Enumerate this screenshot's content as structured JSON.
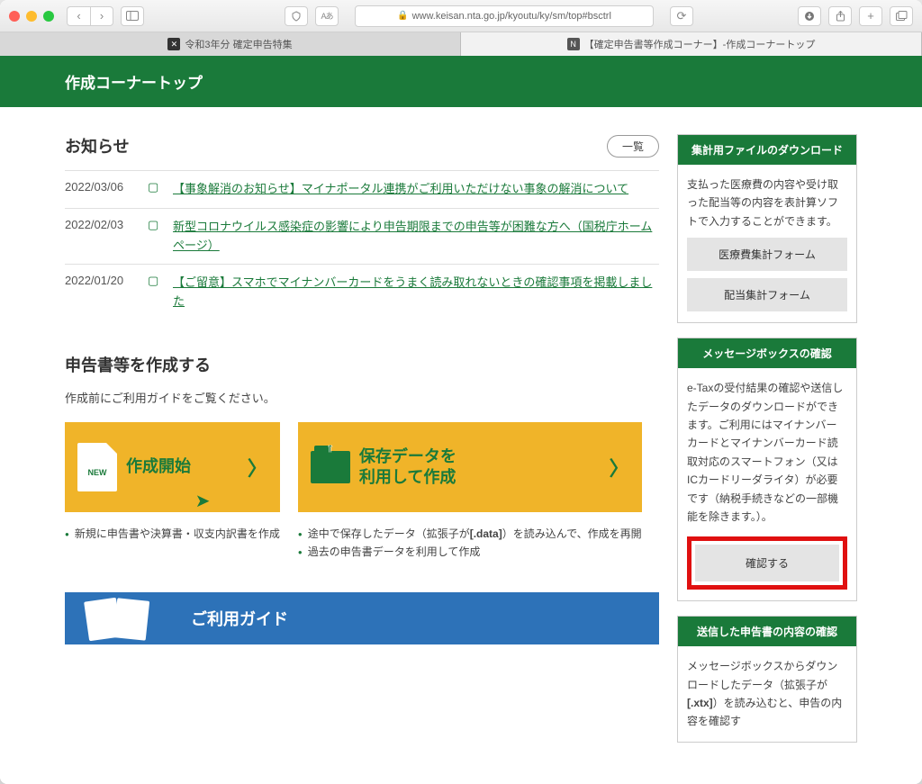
{
  "browser": {
    "url": "www.keisan.nta.go.jp/kyoutu/ky/sm/top#bsctrl",
    "tabs": [
      {
        "label": "令和3年分 確定申告特集"
      },
      {
        "label": "【確定申告書等作成コーナー】-作成コーナートップ"
      }
    ]
  },
  "header": {
    "title": "作成コーナートップ"
  },
  "news": {
    "title": "お知らせ",
    "more": "一覧",
    "items": [
      {
        "date": "2022/03/06",
        "link": "【事象解消のお知らせ】マイナポータル連携がご利用いただけない事象の解消について"
      },
      {
        "date": "2022/02/03",
        "link": "新型コロナウイルス感染症の影響により申告期限までの申告等が困難な方へ（国税庁ホームページ）"
      },
      {
        "date": "2022/01/20",
        "link": "【ご留意】スマホでマイナンバーカードをうまく読み取れないときの確認事項を掲載しました"
      }
    ]
  },
  "create": {
    "title": "申告書等を作成する",
    "desc": "作成前にご利用ガイドをご覧ください。",
    "card1_new": "NEW",
    "card1_label": "作成開始",
    "card2_line1": "保存データを",
    "card2_line2": "利用して作成",
    "bullets1_0": "新規に申告書や決算書・収支内訳書を作成",
    "bullets2_0_a": "途中で保存したデータ（拡張子が",
    "bullets2_0_b": "[.data]",
    "bullets2_0_c": "）を読み込んで、作成を再開",
    "bullets2_1": "過去の申告書データを利用して作成"
  },
  "guide": {
    "label": "ご利用ガイド"
  },
  "side": {
    "p1_title": "集計用ファイルのダウンロード",
    "p1_desc": "支払った医療費の内容や受け取った配当等の内容を表計算ソフトで入力することができます。",
    "p1_btn1": "医療費集計フォーム",
    "p1_btn2": "配当集計フォーム",
    "p2_title": "メッセージボックスの確認",
    "p2_desc": "e-Taxの受付結果の確認や送信したデータのダウンロードができます。ご利用にはマイナンバーカードとマイナンバーカード読取対応のスマートフォン（又はICカードリーダライタ）が必要です（納税手続きなどの一部機能を除きます。）。",
    "p2_btn": "確認する",
    "p3_title": "送信した申告書の内容の確認",
    "p3_desc_a": "メッセージボックスからダウンロードしたデータ（拡張子が",
    "p3_desc_b": "[.xtx]",
    "p3_desc_c": "）を読み込むと、申告の内容を確認す"
  }
}
